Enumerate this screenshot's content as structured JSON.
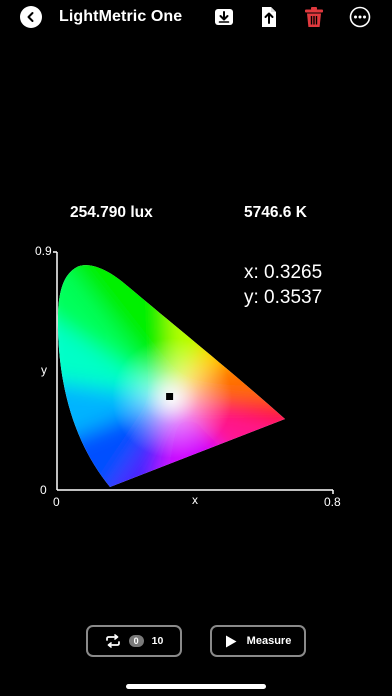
{
  "header": {
    "title": "LightMetric One",
    "icons": [
      "back-icon",
      "download-icon",
      "share-icon",
      "trash-icon",
      "more-icon"
    ]
  },
  "readings": {
    "illuminance": "254.790 lux",
    "cct": "5746.6 K"
  },
  "chart_data": {
    "type": "scatter",
    "title": "",
    "xlabel": "x",
    "ylabel": "y",
    "xlim": [
      0,
      0.8
    ],
    "ylim": [
      0,
      0.9
    ],
    "x_ticks": [
      "0",
      "0.8"
    ],
    "y_ticks": [
      "0",
      "0.9"
    ],
    "grid": false,
    "background": "CIE 1931 chromaticity diagram",
    "point": {
      "x": 0.3265,
      "y": 0.3537
    },
    "annotation": [
      "x: 0.3265",
      "y: 0.3537"
    ]
  },
  "controls": {
    "repeat_count": "0",
    "repeat_total": "10",
    "measure_label": "Measure"
  },
  "colors": {
    "background": "#000000",
    "trash": "#e0393e",
    "button_border": "#8a8a8a"
  }
}
